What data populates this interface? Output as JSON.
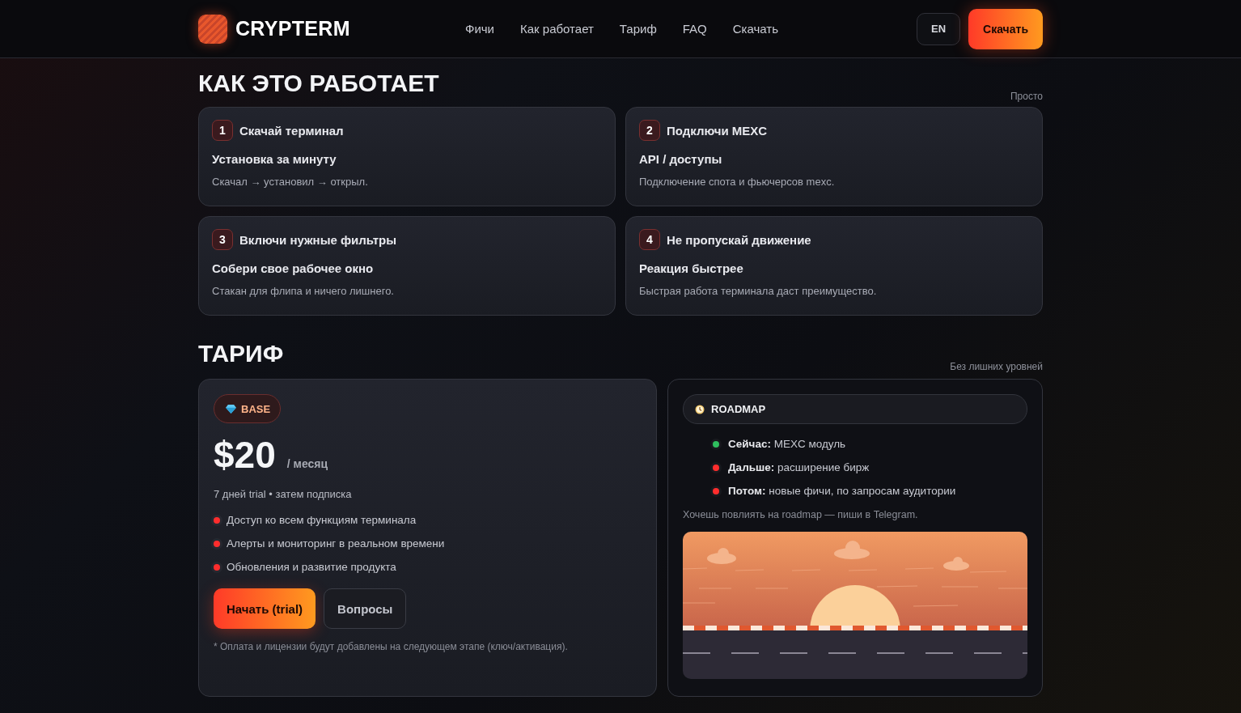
{
  "header": {
    "logo_text": "CRYPTERM",
    "nav": [
      "Фичи",
      "Как работает",
      "Тариф",
      "FAQ",
      "Скачать"
    ],
    "lang_button": "EN",
    "download_button": "Скачать"
  },
  "how_it_works": {
    "title": "КАК ЭТО РАБОТАЕТ",
    "tagline": "Просто",
    "steps": [
      {
        "number": "1",
        "title": "Скачай терминал",
        "subtitle": "Установка за минуту",
        "text": "Скачал → установил → открыл."
      },
      {
        "number": "2",
        "title": "Подключи MEXC",
        "subtitle": "API / доступы",
        "text": "Подключение спота и фьючерсов mexc."
      },
      {
        "number": "3",
        "title": "Включи нужные фильтры",
        "subtitle": "Собери свое рабочее окно",
        "text": "Стакан для флипа и ничего лишнего."
      },
      {
        "number": "4",
        "title": "Не пропускай движение",
        "subtitle": "Реакция быстрее",
        "text": "Быстрая работа терминала даст преимущество."
      }
    ]
  },
  "pricing": {
    "title": "ТАРИФ",
    "tagline": "Без лишних уровней",
    "plan": {
      "badge": "BASE",
      "price": "$20",
      "period": "/ месяц",
      "trial_note": "7 дней trial • затем подписка",
      "features": [
        "Доступ ко всем функциям терминала",
        "Алерты и мониторинг в реальном времени",
        "Обновления и развитие продукта"
      ],
      "primary_button": "Начать (trial)",
      "secondary_button": "Вопросы",
      "footnote": "* Оплата и лицензии будут добавлены на следующем этапе (ключ/активация)."
    },
    "roadmap": {
      "badge": "ROADMAP",
      "items": [
        {
          "text": "**Сейчас:** MEXC модуль",
          "color": "#2fbf5f"
        },
        {
          "text": "**Дальше:** расширение бирж",
          "color": "#ff2d2d"
        },
        {
          "text": "**Потом:** новые фичи, по запросам аудитории",
          "color": "#ff2d2d"
        }
      ],
      "note": "Хочешь повлиять на roadmap — пиши в Telegram."
    }
  }
}
